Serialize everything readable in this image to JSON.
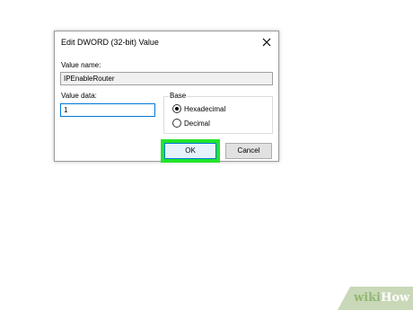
{
  "dialog": {
    "title": "Edit DWORD (32-bit) Value",
    "value_name_label": "Value name:",
    "value_name": "IPEnableRouter",
    "value_data_label": "Value data:",
    "value_data": "1",
    "base_label": "Base",
    "radio_hex": "Hexadecimal",
    "radio_dec": "Decimal",
    "selected_base": "Hexadecimal",
    "ok_label": "OK",
    "cancel_label": "Cancel"
  },
  "highlight_color": "#22e52a",
  "watermark": {
    "wiki": "wiki",
    "how": "How"
  }
}
